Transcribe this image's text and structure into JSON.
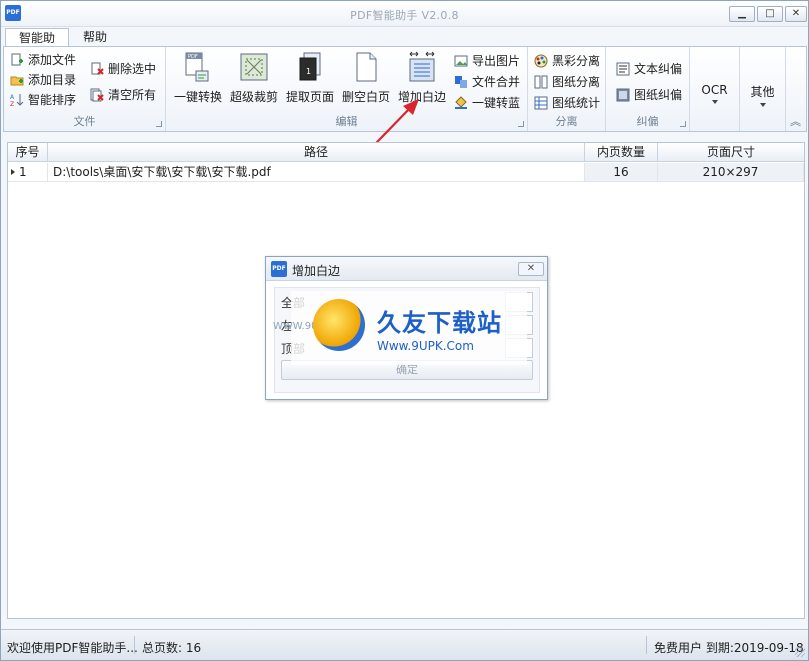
{
  "window": {
    "title": "PDF智能助手 V2.0.8",
    "app_icon": "PDF",
    "controls": {
      "minimize": "▁",
      "maximize": "□",
      "close": "✕"
    }
  },
  "tabs": [
    {
      "label": "智能助手",
      "active": true
    },
    {
      "label": "帮助",
      "active": false
    }
  ],
  "ribbon": {
    "file_group": {
      "label": "文件",
      "items": [
        "添加文件",
        "添加目录",
        "智能排序",
        "删除选中",
        "清空所有"
      ]
    },
    "edit_group": {
      "label": "编辑",
      "large_items": [
        "一键转换",
        "超级裁剪",
        "提取页面",
        "删空白页",
        "增加白边"
      ],
      "small_items": [
        "导出图片",
        "文件合并",
        "一键转蓝"
      ]
    },
    "separate_group": {
      "label": "分离",
      "items": [
        "黑彩分离",
        "图纸分离",
        "图纸统计"
      ]
    },
    "correct_group": {
      "label": "纠偏",
      "items": [
        "文本纠偏",
        "图纸纠偏"
      ]
    },
    "ocr_label": "OCR",
    "other_label": "其他",
    "collapse_icon": "︽"
  },
  "table": {
    "columns": [
      "序号",
      "路径",
      "内页数量",
      "页面尺寸"
    ],
    "rows": [
      {
        "index": "1",
        "path": "D:\\tools\\桌面\\安下载\\安下载\\安下载.pdf",
        "pages": "16",
        "size": "210×297"
      }
    ]
  },
  "dialog": {
    "title": "增加白边",
    "icon": "PDF",
    "close": "✕",
    "labels": [
      "全部",
      "左",
      "顶部"
    ],
    "ok_label": "确定"
  },
  "watermark": {
    "title": "久友下载站",
    "subtitle": "Www.9UPK.Com",
    "small": "WWW.9UPK.COM"
  },
  "status": {
    "welcome": "欢迎使用PDF智能助手...",
    "total_pages": "总页数: 16",
    "user": "免费用户 到期:2019-09-18"
  },
  "colors": {
    "accent": "#2b6ed6",
    "arrow": "#d8262b",
    "watermark": "#1d5fc9"
  }
}
